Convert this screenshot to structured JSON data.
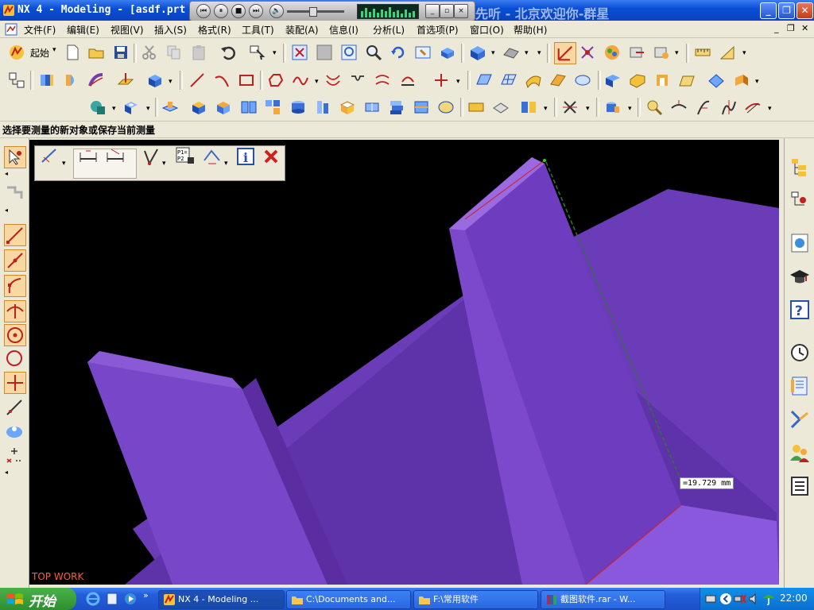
{
  "window": {
    "title": "NX 4 - Modeling - [asdf.prt",
    "marquee": "先听 - 北京欢迎你-群星"
  },
  "media": {
    "buttons": [
      "prev",
      "pause",
      "stop",
      "next"
    ],
    "vol_label": "volume"
  },
  "menubar": {
    "items": [
      "文件(F)",
      "编辑(E)",
      "视图(V)",
      "插入(S)",
      "格式(R)",
      "工具(T)",
      "装配(A)",
      "信息(I)",
      "分析(L)",
      "首选项(P)",
      "窗口(O)",
      "帮助(H)"
    ]
  },
  "toolbar": {
    "start_label": "起始"
  },
  "cue": {
    "text": "选择要测量的新对象或保存当前测量"
  },
  "viewport": {
    "work_view_label": "TOP WORK",
    "measurement": "=19.729 mm",
    "background": "#000000",
    "model_color": "#6a3cc0"
  },
  "taskbar": {
    "start_label": "开始",
    "tasks": [
      {
        "label": "NX 4 - Modeling ..."
      },
      {
        "label": "C:\\Documents and..."
      },
      {
        "label": "F:\\常用软件"
      },
      {
        "label": "截图软件.rar - W..."
      }
    ],
    "clock": "22:00"
  }
}
